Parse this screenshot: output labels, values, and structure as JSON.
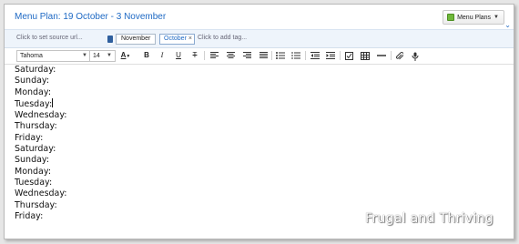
{
  "note": {
    "title": "Menu Plan: 19 October - 3 November",
    "notebook_button_label": "Menu Plans",
    "source_placeholder": "Click to set source url...",
    "notebook_name": "November",
    "tags": [
      {
        "label": "October"
      }
    ],
    "tag_remove_glyph": "×",
    "add_tag_placeholder": "Click to add tag..."
  },
  "toolbar": {
    "font_family_value": "Tahoma",
    "font_size_value": "14",
    "bold_glyph": "B",
    "italic_glyph": "I",
    "underline_glyph": "U",
    "strike_glyph": "T",
    "text_color_glyph": "A"
  },
  "content": {
    "lines": [
      "Saturday:",
      "Sunday:",
      "Monday:",
      "Tuesday:",
      "Wednesday:",
      "Thursday:",
      "Friday:",
      "Saturday:",
      "Sunday:",
      "Monday:",
      "Tuesday:",
      "Wednesday:",
      "Thursday:",
      "Friday:"
    ]
  },
  "watermark": "Frugal and Thriving",
  "colors": {
    "title_blue": "#1e69c4",
    "meta_bar_bg": "#eef4fb",
    "notebook_icon_green": "#6fb83a"
  },
  "icons": {
    "notebook_button": "evernote-notebook-icon",
    "dropdown": "caret-down-icon",
    "align": [
      "align-left-icon",
      "align-center-icon",
      "align-right-icon",
      "align-justify-icon"
    ],
    "lists": [
      "bulleted-list-icon",
      "numbered-list-icon"
    ],
    "indent": [
      "outdent-icon",
      "indent-icon"
    ],
    "insert": [
      "checkbox-icon",
      "table-icon",
      "horizontal-rule-icon",
      "attachment-icon",
      "microphone-icon"
    ]
  }
}
